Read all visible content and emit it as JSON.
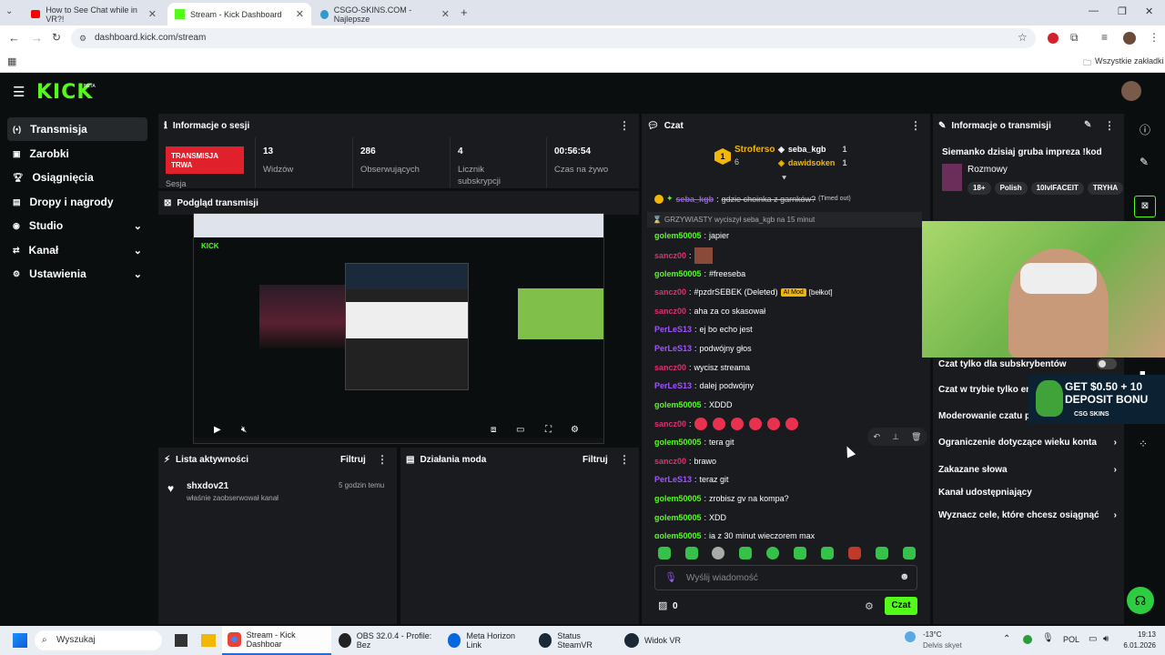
{
  "browser": {
    "tabs": [
      {
        "label": "How to See Chat while in VR?!"
      },
      {
        "label": "Stream - Kick Dashboard"
      },
      {
        "label": "CSGO-SKINS.COM - Najlepsze"
      }
    ],
    "url": "dashboard.kick.com/stream",
    "bookmarks_label": "Wszystkie zakładki"
  },
  "kick": {
    "logo": "KICK",
    "beta": "BETA"
  },
  "sidebar": {
    "items": [
      {
        "label": "Transmisja",
        "icon": "broadcast-icon"
      },
      {
        "label": "Zarobki",
        "icon": "wallet-icon"
      },
      {
        "label": "Osiągnięcia",
        "icon": "trophy-icon"
      },
      {
        "label": "Dropy i nagrody",
        "icon": "gift-icon"
      },
      {
        "label": "Studio",
        "icon": "studio-icon"
      },
      {
        "label": "Kanał",
        "icon": "channel-icon"
      },
      {
        "label": "Ustawienia",
        "icon": "gear-icon"
      }
    ]
  },
  "session": {
    "title": "Informacje o sesji",
    "live_badge": "TRANSMISJA TRWA",
    "session_label": "Sesja",
    "stats": [
      {
        "value": "13",
        "label": "Widzów"
      },
      {
        "value": "286",
        "label": "Obserwujących"
      },
      {
        "value": "4",
        "label": "Licznik subskrypcji"
      },
      {
        "value": "00:56:54",
        "label": "Czas na żywo"
      }
    ]
  },
  "preview": {
    "title": "Podgląd transmisji"
  },
  "activity": {
    "title": "Lista aktywności",
    "filter": "Filtruj",
    "items": [
      {
        "user": "shxdov21",
        "text": "właśnie zaobserwował kanał",
        "time": "5 godzin temu"
      }
    ]
  },
  "mod_actions": {
    "title": "Działania moda",
    "filter": "Filtruj"
  },
  "chat": {
    "title": "Czat",
    "leaderboard": [
      {
        "rank": "1",
        "name": "Stroferso",
        "value": "6"
      },
      {
        "name": "seba_kgb",
        "value": "1"
      },
      {
        "name": "dawidsoken",
        "value": "1"
      }
    ],
    "messages": [
      {
        "user": "seba_kgb",
        "text": "gdzie choinka z garnków?",
        "suffix": "(Timed out)",
        "color": "p",
        "strike": true
      },
      {
        "system": true,
        "text": "GRZYWIASTY wyciszył seba_kgb na 15 minut"
      },
      {
        "user": "golem50005",
        "text": "japier",
        "color": "g"
      },
      {
        "user": "sancz00",
        "text": "",
        "color": "r",
        "emote": true
      },
      {
        "user": "golem50005",
        "text": "#freeseba",
        "color": "g"
      },
      {
        "user": "sancz00",
        "text": "#pzdrSEBEK (Deleted)",
        "badge": "AI Mod",
        "suffix": "[bełkot]",
        "color": "r"
      },
      {
        "user": "sancz00",
        "text": "aha za co skasował",
        "color": "r"
      },
      {
        "user": "PerLeS13",
        "text": "ej bo echo jest",
        "color": "p"
      },
      {
        "user": "PerLeS13",
        "text": "podwójny głos",
        "color": "p"
      },
      {
        "user": "sancz00",
        "text": "wycisz streama",
        "color": "r"
      },
      {
        "user": "PerLeS13",
        "text": "dalej podwójny",
        "color": "p"
      },
      {
        "user": "golem50005",
        "text": "XDDD",
        "color": "g"
      },
      {
        "user": "sancz00",
        "text": "",
        "color": "r",
        "hearts": 6
      },
      {
        "user": "golem50005",
        "text": "tera git",
        "color": "g"
      },
      {
        "user": "sancz00",
        "text": "brawo",
        "color": "r"
      },
      {
        "user": "PerLeS13",
        "text": "teraz git",
        "color": "p"
      },
      {
        "user": "golem50005",
        "text": "zrobisz gv na kompa?",
        "color": "g"
      },
      {
        "user": "golem50005",
        "text": "XDD",
        "color": "g"
      },
      {
        "user": "golem50005",
        "text": "ja z 30 minut wieczorem max",
        "color": "g"
      }
    ],
    "input_placeholder": "Wyślij wiadomość",
    "points": "0",
    "send_label": "Czat"
  },
  "stream_info": {
    "title": "Informacje o transmisji",
    "stream_title": "Siemanko dzisiaj gruba impreza !kod",
    "category": "Rozmowy",
    "tags": [
      "18+",
      "Polish",
      "10lvlFACEIT",
      "TRYHA"
    ],
    "settings": [
      {
        "label": "Czat tylko dla subskrybentów",
        "type": "toggle"
      },
      {
        "label": "Czat w trybie tylko em",
        "type": "none"
      },
      {
        "label": "Moderowanie czatu pr",
        "type": "none"
      },
      {
        "label": "Ograniczenie dotyczące wieku konta",
        "type": "chevron"
      },
      {
        "label": "Zakazane słowa",
        "type": "chevron"
      },
      {
        "label": "Kanał udostępniający",
        "type": "none"
      },
      {
        "label": "Wyznacz cele, które chcesz osiągnąć",
        "type": "chevron"
      }
    ]
  },
  "ad": {
    "line1": "GET $0.50 + 10",
    "line2": "DEPOSIT BONU",
    "brand": "CSG SKINS"
  },
  "taskbar": {
    "search": "Wyszukaj",
    "apps": [
      {
        "label": "Stream - Kick Dashboar"
      },
      {
        "label": "OBS 32.0.4 - Profile: Bez"
      },
      {
        "label": "Meta Horizon Link"
      },
      {
        "label": "Status SteamVR"
      },
      {
        "label": "Widok VR"
      }
    ],
    "weather_temp": "-13°C",
    "weather_desc": "Delvis skyet",
    "lang": "POL",
    "time": "19:13",
    "date": "6.01.2026"
  }
}
